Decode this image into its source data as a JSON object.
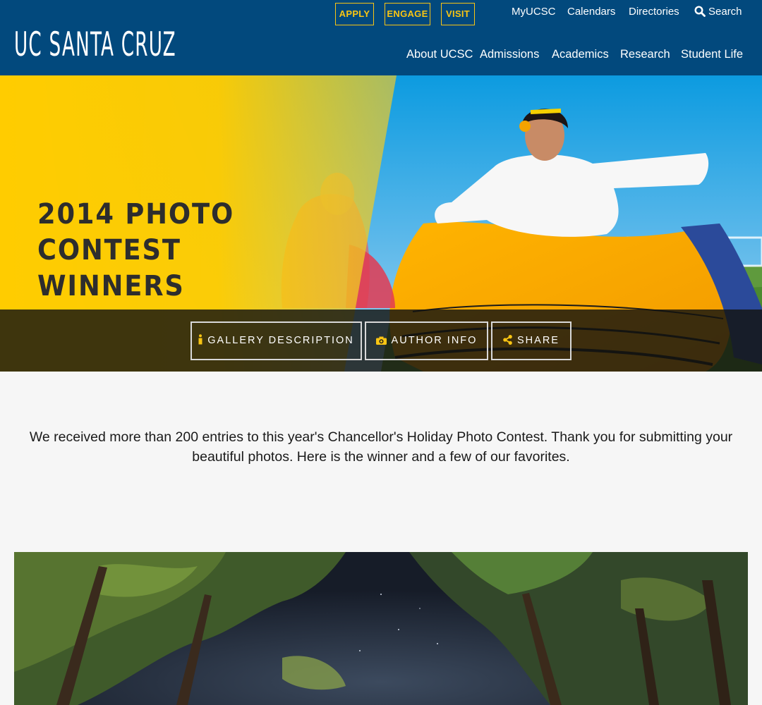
{
  "header": {
    "logo_text": "UC SANTA CRUZ",
    "cta": {
      "apply": "APPLY",
      "engage": "ENGAGE",
      "visit": "VISIT"
    },
    "utility_nav": {
      "myucsc": "MyUCSC",
      "calendars": "Calendars",
      "directories": "Directories",
      "search": "Search"
    },
    "main_nav": {
      "about": "About UCSC",
      "admissions": "Admissions",
      "academics": "Academics",
      "research": "Research",
      "student_life": "Student Life"
    },
    "colors": {
      "background": "#02497d",
      "accent": "#f9c513"
    }
  },
  "hero": {
    "title": "2014 PHOTO\nCONTEST WINNERS",
    "buttons": {
      "gallery": "GALLERY DESCRIPTION",
      "author": "AUTHOR INFO",
      "share": "SHARE"
    },
    "icons": {
      "gallery": "info-icon",
      "author": "camera-icon",
      "share": "share-icon"
    },
    "colors": {
      "yellow": "#ffcc00",
      "sky": "#2a9fde"
    }
  },
  "intro": {
    "text": "We received more than 200 entries to this year's Chancellor's Holiday Photo Contest. Thank you for submitting your beautiful photos. Here is the winner and a few of our favorites."
  }
}
